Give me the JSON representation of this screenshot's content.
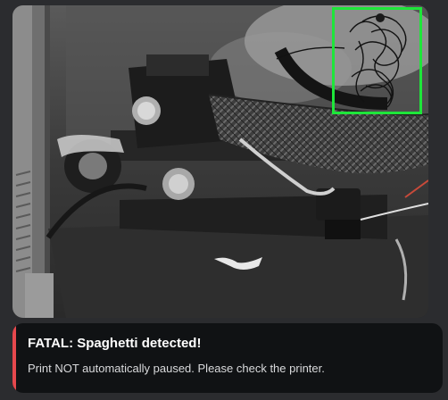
{
  "camera": {
    "detection_color": "#1ee63a"
  },
  "alert": {
    "title": "FATAL: Spaghetti detected!",
    "message": "Print NOT automatically paused. Please check the printer.",
    "accent_color": "#e5484d"
  }
}
